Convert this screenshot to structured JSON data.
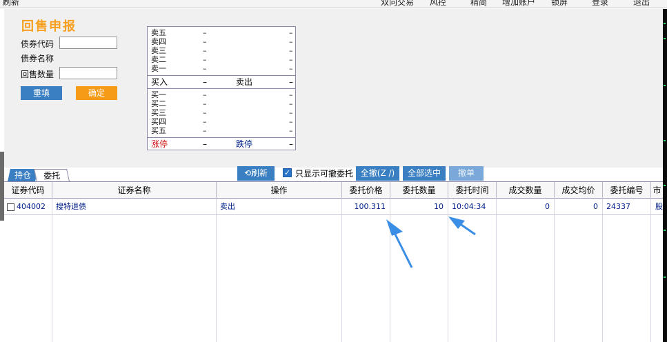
{
  "topbar": {
    "items": [
      "刷新",
      "双向交易",
      "风控",
      "精简",
      "增加账户",
      "锁屏",
      "登录",
      "退出"
    ]
  },
  "form": {
    "title": "回售申报",
    "bond_code_label": "债券代码",
    "bond_name_label": "债券名称",
    "quantity_label": "回售数量",
    "bond_code_value": "",
    "quantity_value": "",
    "reset_label": "重填",
    "confirm_label": "确定"
  },
  "quote": {
    "sell_levels": [
      {
        "label": "卖五",
        "price": "–",
        "vol": "–"
      },
      {
        "label": "卖四",
        "price": "–",
        "vol": "–"
      },
      {
        "label": "卖三",
        "price": "–",
        "vol": "–"
      },
      {
        "label": "卖二",
        "price": "–",
        "vol": "–"
      },
      {
        "label": "卖一",
        "price": "–",
        "vol": "–"
      }
    ],
    "mid": {
      "buy_label": "买入",
      "buy_value": "–",
      "sell_label": "卖出",
      "sell_value": "–"
    },
    "buy_levels": [
      {
        "label": "买一",
        "price": "–",
        "vol": "–"
      },
      {
        "label": "买二",
        "price": "–",
        "vol": "–"
      },
      {
        "label": "买三",
        "price": "–",
        "vol": "–"
      },
      {
        "label": "买四",
        "price": "–",
        "vol": "–"
      },
      {
        "label": "买五",
        "price": "–",
        "vol": "–"
      }
    ],
    "limit": {
      "up_label": "涨停",
      "up_value": "–",
      "down_label": "跌停",
      "down_value": "–"
    }
  },
  "tabs": [
    {
      "label": "持仓",
      "active": false
    },
    {
      "label": "委托",
      "active": true
    }
  ],
  "toolbar": {
    "refresh_label": "刷新",
    "only_cancelable_label": "只显示可撤委托",
    "only_cancelable_checked": "✓",
    "cancel_all_label": "全撤(Z /)",
    "select_all_label": "全部选中",
    "cancel_label": "撤单"
  },
  "table": {
    "columns": [
      "证券代码",
      "证券名称",
      "操作",
      "委托价格",
      "委托数量",
      "委托时间",
      "成交数量",
      "成交均价",
      "委托编号",
      "市"
    ],
    "rows": [
      {
        "code": "404002",
        "name": "搜特退债",
        "op": "卖出",
        "price": "100.311",
        "qty": "10",
        "time": "10:04:34",
        "filled_qty": "0",
        "avg_price": "0",
        "order_no": "24337",
        "market": "股"
      }
    ]
  },
  "colors": {
    "accent_blue": "#3a7fc1",
    "accent_orange": "#f59b17",
    "title_orange": "#f7a020",
    "limit_up_red": "#d01010",
    "limit_down_blue": "#00208a",
    "annotation_arrow": "#3a8ee6"
  }
}
